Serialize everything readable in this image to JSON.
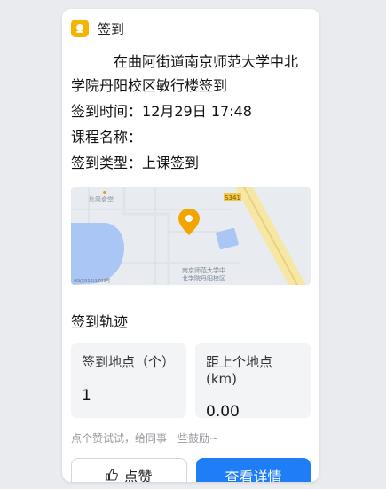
{
  "header": {
    "title": "签到",
    "icon": "checkin-app-icon"
  },
  "checkin": {
    "location_line1": "在曲阿街道南京师范大学中北",
    "location_line2": "学院丹阳校区敏行楼签到",
    "time_label": "签到时间：",
    "time_value": "12月29日 17:48",
    "course_label": "课程名称：",
    "course_value": "",
    "type_label": "签到类型：",
    "type_value": "上课签到"
  },
  "map": {
    "poi_canteen": "比简食堂",
    "road_label": "S341",
    "campus_label_1": "南京师范大学中",
    "campus_label_2": "北学院丹阳校区",
    "copyright": "GS(2018)1709号",
    "pin_color": "#f0a500"
  },
  "track": {
    "title": "签到轨迹",
    "stats": [
      {
        "label": "签到地点（个）",
        "value": "1"
      },
      {
        "label": "距上个地点(km)",
        "value": "0.00"
      }
    ]
  },
  "hint": "点个赞试试，给同事一些鼓励~",
  "buttons": {
    "like": "点赞",
    "detail": "查看详情"
  },
  "colors": {
    "accent": "#1f7df5",
    "icon_yellow": "#f4b400"
  }
}
